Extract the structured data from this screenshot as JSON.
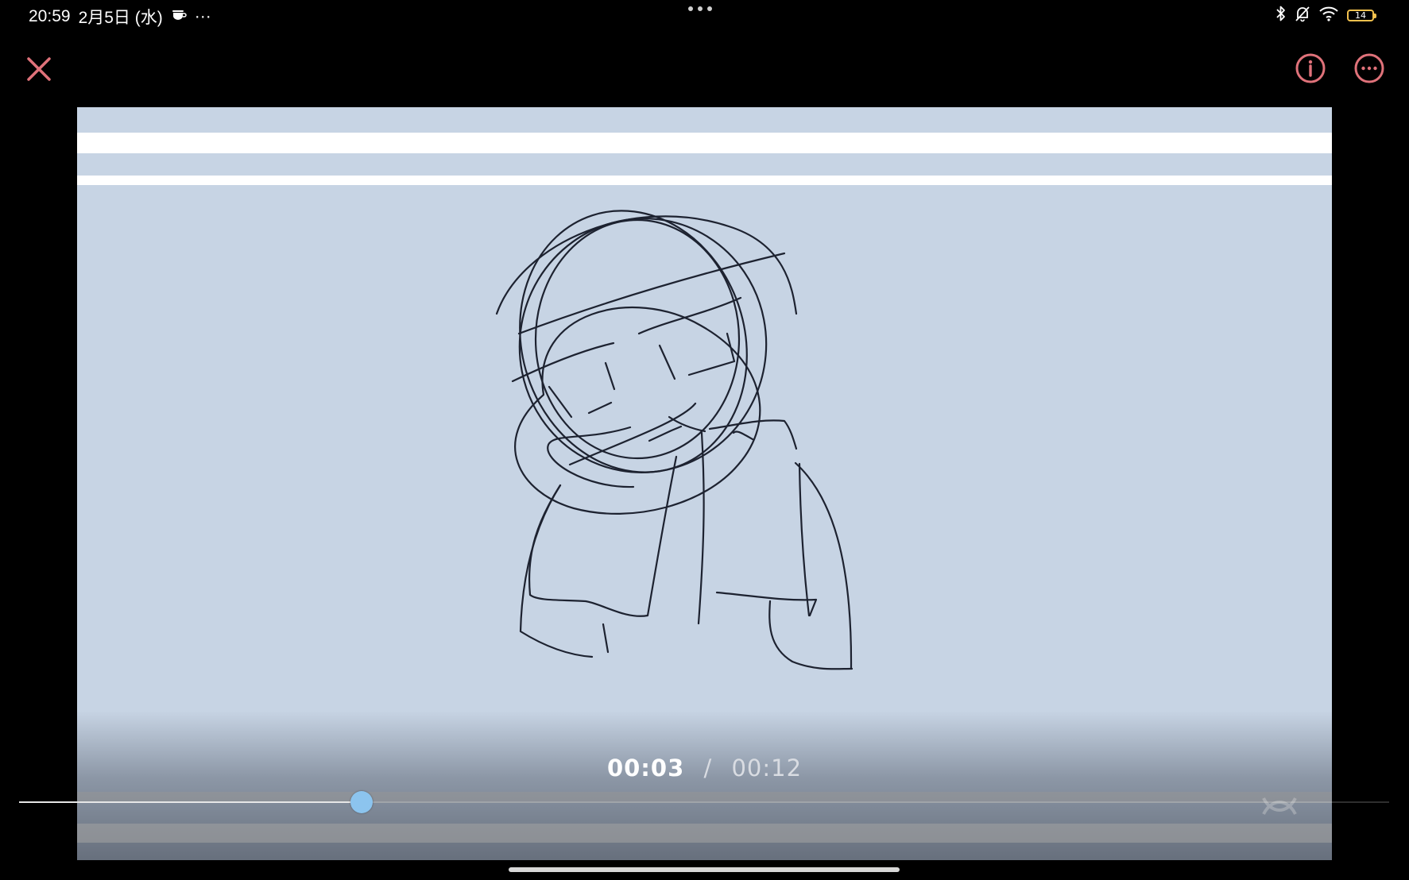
{
  "status_bar": {
    "time": "20:59",
    "date": "2月5日 (水)",
    "overflow": "···",
    "battery_level": "14",
    "icons": [
      "app-notification-icon",
      "bluetooth-icon",
      "silent-bell-icon",
      "wifi-icon",
      "battery-icon"
    ]
  },
  "toolbar": {
    "close_icon": "close-icon",
    "info_icon": "info-icon",
    "more_icon": "more-options-icon",
    "accent_color": "#e0727a"
  },
  "player": {
    "current_time": "00:03",
    "separator": "/",
    "total_time": "00:12",
    "progress": 0.25,
    "thumb_color": "#8cc4ee"
  },
  "video": {
    "background_color": "#c7d4e4",
    "content": "sketch-drawing"
  }
}
